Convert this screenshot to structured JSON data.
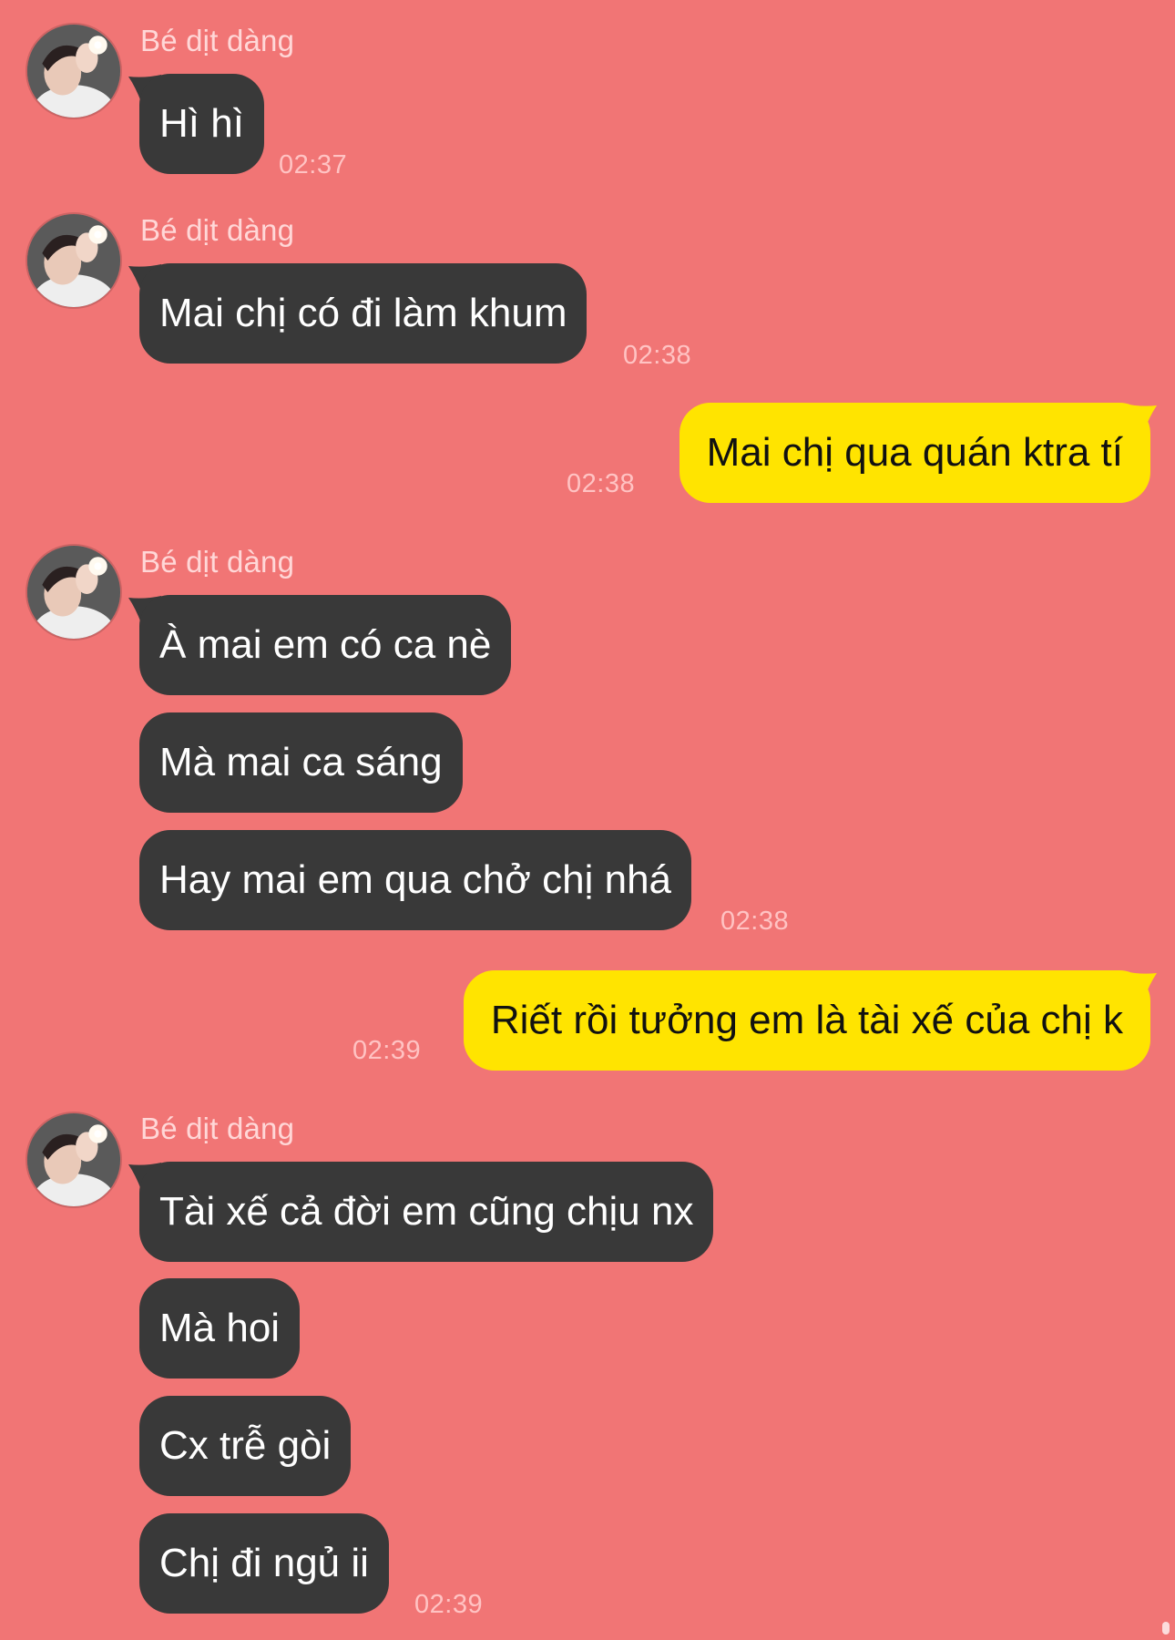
{
  "colors": {
    "background": "#F17575",
    "incoming_bubble": "#393939",
    "outgoing_bubble": "#FFE400",
    "timestamp": "#FFC3C3",
    "sender_name": "#FFD7D7"
  },
  "contact": {
    "name": "Bé dịt dàng",
    "avatar_icon": "selfie-avatar"
  },
  "messages": [
    {
      "side": "in",
      "sender": "Bé dịt dàng",
      "text": "Hì hì",
      "time": "02:37"
    },
    {
      "side": "in",
      "sender": "Bé dịt dàng",
      "text": "Mai chị có đi làm khum",
      "time": "02:38"
    },
    {
      "side": "out",
      "text": "Mai chị qua quán ktra tí",
      "time": "02:38"
    },
    {
      "side": "in",
      "sender": "Bé dịt dàng",
      "text": "À mai em có ca nè"
    },
    {
      "side": "in",
      "text": "Mà mai ca sáng"
    },
    {
      "side": "in",
      "text": "Hay mai em qua chở chị nhá",
      "time": "02:38"
    },
    {
      "side": "out",
      "text": "Riết rồi tưởng em là tài xế của chị k",
      "time": "02:39"
    },
    {
      "side": "in",
      "sender": "Bé dịt dàng",
      "text": "Tài xế cả đời em cũng chịu nx"
    },
    {
      "side": "in",
      "text": "Mà hoi"
    },
    {
      "side": "in",
      "text": "Cx trễ gòi"
    },
    {
      "side": "in",
      "text": "Chị đi ngủ ii",
      "time": "02:39"
    }
  ]
}
